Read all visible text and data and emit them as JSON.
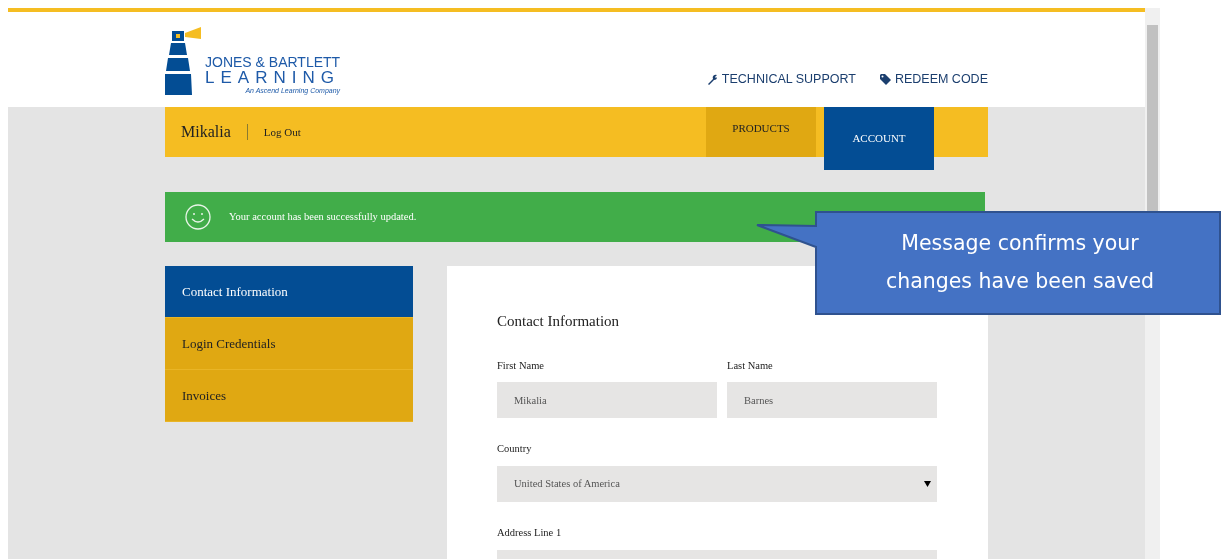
{
  "logo": {
    "line1": "JONES & BARTLETT",
    "line2": "LEARNING",
    "tagline": "An Ascend Learning Company"
  },
  "header_links": [
    {
      "kind": "wrench",
      "label": "TECHNICAL SUPPORT"
    },
    {
      "kind": "tag",
      "label": "REDEEM CODE"
    }
  ],
  "user": {
    "name": "Mikalia",
    "logout": "Log Out"
  },
  "main_nav": [
    {
      "label": "PRODUCTS",
      "selected": false
    },
    {
      "label": "ACCOUNT",
      "selected": true
    }
  ],
  "alert": {
    "message": "Your account has been successfully updated."
  },
  "sidebar": {
    "items": [
      {
        "label": "Contact Information",
        "selected": true
      },
      {
        "label": "Login Credentials",
        "selected": false
      },
      {
        "label": "Invoices",
        "selected": false
      }
    ]
  },
  "form": {
    "title": "Contact Information",
    "fields": [
      {
        "kind": "text",
        "label": "First Name",
        "value": "Mikalia"
      },
      {
        "kind": "text",
        "label": "Last Name",
        "value": "Barnes"
      },
      {
        "kind": "select",
        "label": "Country",
        "value": "United States of America"
      },
      {
        "kind": "text",
        "label": "Address Line 1"
      }
    ]
  },
  "callout": {
    "text": "Message confirms your changes have been saved"
  }
}
